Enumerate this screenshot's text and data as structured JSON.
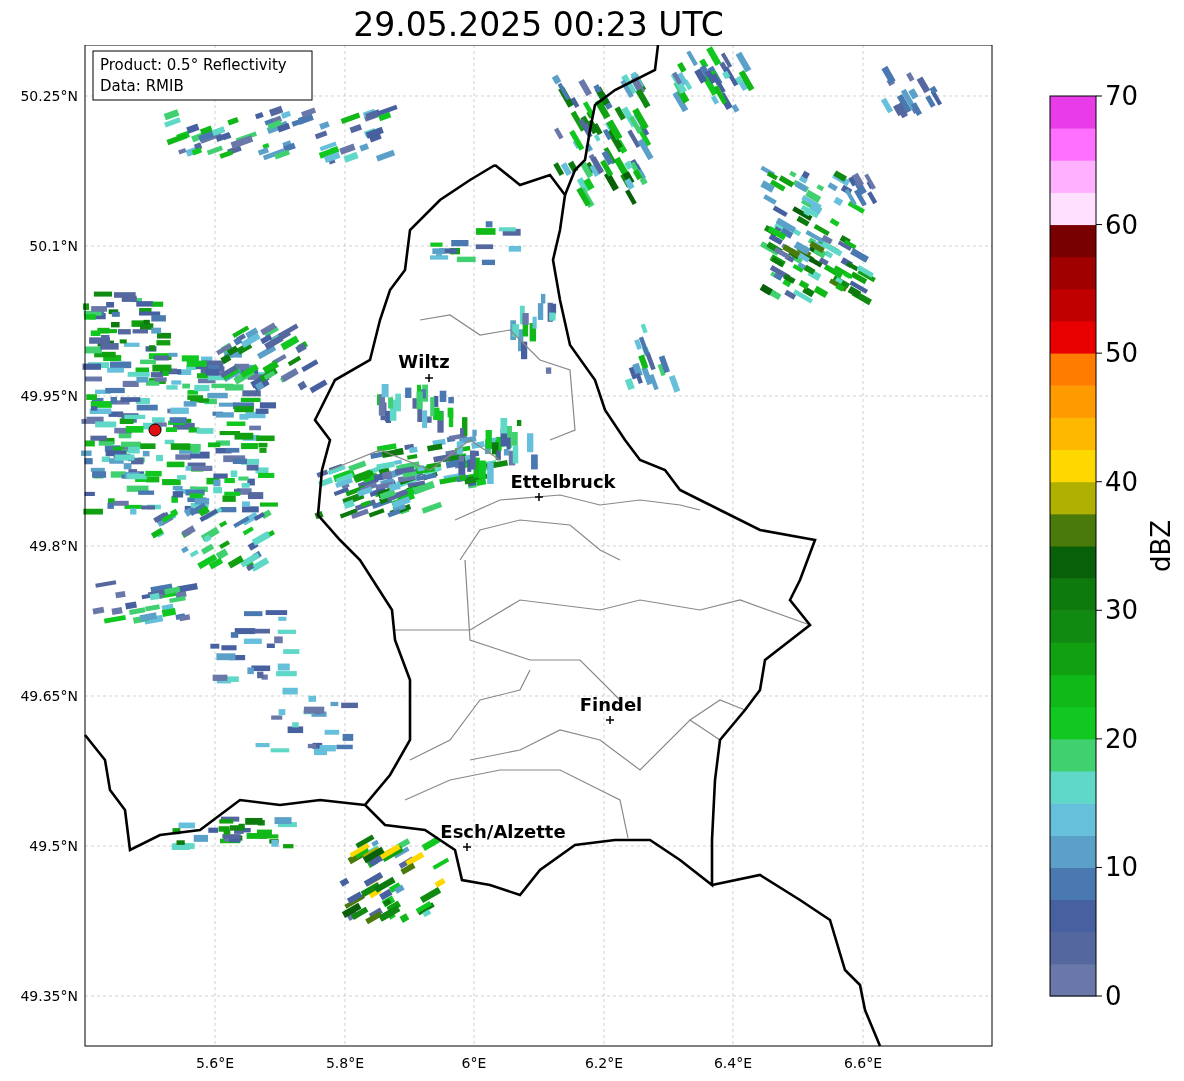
{
  "title": "29.05.2025 00:23 UTC",
  "info_box": {
    "lines": [
      "Product: 0.5° Reflectivity",
      "Data: RMIB"
    ]
  },
  "map": {
    "lat_labels": [
      "50.25°N",
      "50.1°N",
      "49.95°N",
      "49.8°N",
      "49.65°N",
      "49.5°N",
      "49.35°N"
    ],
    "lon_labels": [
      "5.6°E",
      "5.8°E",
      "6°E",
      "6.2°E",
      "6.4°E",
      "6.6°E"
    ],
    "cities": [
      {
        "name": "Wiltz"
      },
      {
        "name": "Ettelbruck"
      },
      {
        "name": "Findel"
      },
      {
        "name": "Esch/Alzette"
      }
    ]
  },
  "colorbar": {
    "label": "dBZ",
    "ticks": [
      "70",
      "60",
      "50",
      "40",
      "30",
      "20",
      "10",
      "0"
    ],
    "segments": [
      {
        "color": "#6978a8"
      },
      {
        "color": "#54679e"
      },
      {
        "color": "#4660a0"
      },
      {
        "color": "#4a78b0"
      },
      {
        "color": "#5aa0c8"
      },
      {
        "color": "#66c0dc"
      },
      {
        "color": "#60d8c8"
      },
      {
        "color": "#40d070"
      },
      {
        "color": "#10c820"
      },
      {
        "color": "#10b818"
      },
      {
        "color": "#10a010"
      },
      {
        "color": "#108a10"
      },
      {
        "color": "#0c7a0c"
      },
      {
        "color": "#086008"
      },
      {
        "color": "#4a7a0a"
      },
      {
        "color": "#b0b000"
      },
      {
        "color": "#ffd800"
      },
      {
        "color": "#ffb800"
      },
      {
        "color": "#ff9a00"
      },
      {
        "color": "#ff7c00"
      },
      {
        "color": "#e80000"
      },
      {
        "color": "#c00000"
      },
      {
        "color": "#a00000"
      },
      {
        "color": "#780000"
      },
      {
        "color": "#ffe0ff"
      },
      {
        "color": "#ffb0ff"
      },
      {
        "color": "#ff70ff"
      },
      {
        "color": "#e83ce8"
      }
    ]
  }
}
